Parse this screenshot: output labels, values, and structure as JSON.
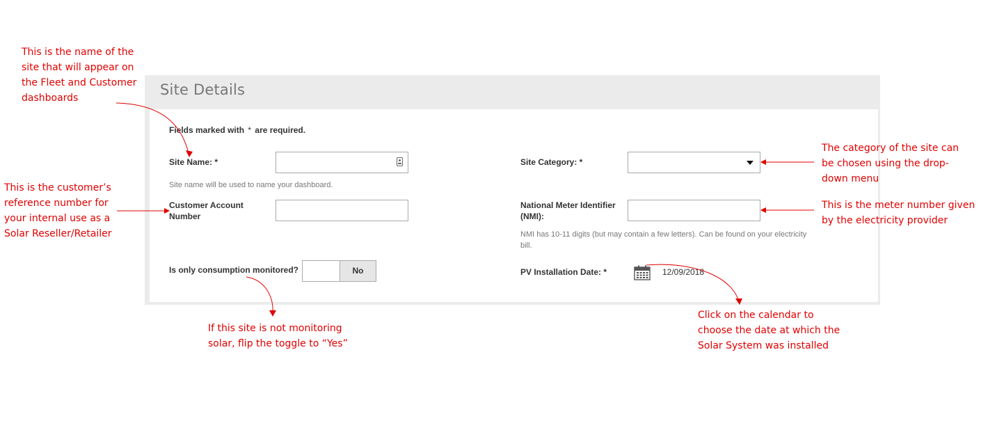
{
  "panel": {
    "title": "Site Details",
    "required_note": "Fields marked with",
    "required_star": "*",
    "required_suffix": "are required."
  },
  "form": {
    "site_name": {
      "label": "Site Name: *",
      "value": "",
      "hint": "Site name will be used to name your dashboard.",
      "icon": "contact-card-icon"
    },
    "customer_account": {
      "label_line1": "Customer Account",
      "label_line2": "Number",
      "value": ""
    },
    "consumption_only": {
      "label": "Is only consumption monitored?",
      "toggle_value": "No"
    },
    "site_category": {
      "label": "Site Category: *",
      "selected": "",
      "icon": "caret-down-icon"
    },
    "nmi": {
      "label_line1": "National Meter Identifier",
      "label_line2": "(NMI):",
      "value": "",
      "hint_line1": "NMI has 10-11 digits (but may contain a few letters). Can be found on your electricity",
      "hint_line2": "bill."
    },
    "pv_install": {
      "label": "PV Installation Date: *",
      "value": "12/09/2018",
      "icon": "calendar-icon"
    }
  },
  "annotations": {
    "site_name": [
      "This is the name of the",
      "site that will appear on",
      "the Fleet and Customer",
      "dashboards"
    ],
    "customer_account": [
      "This is the customer’s",
      "reference number for",
      "your internal use as a",
      "Solar Reseller/Retailer"
    ],
    "consumption": [
      "If this site is not monitoring",
      "solar, flip the toggle to “Yes”"
    ],
    "site_category": [
      "The category of the site can",
      "be chosen using the drop-",
      "down menu"
    ],
    "nmi": [
      "This is the meter number given",
      "by the electricity provider"
    ],
    "calendar": [
      "Click on the calendar to",
      "choose the date at which the",
      "Solar System was installed"
    ]
  },
  "colors": {
    "annotation": "#e00000",
    "panel_bg": "#ebebeb",
    "title": "#777777"
  }
}
